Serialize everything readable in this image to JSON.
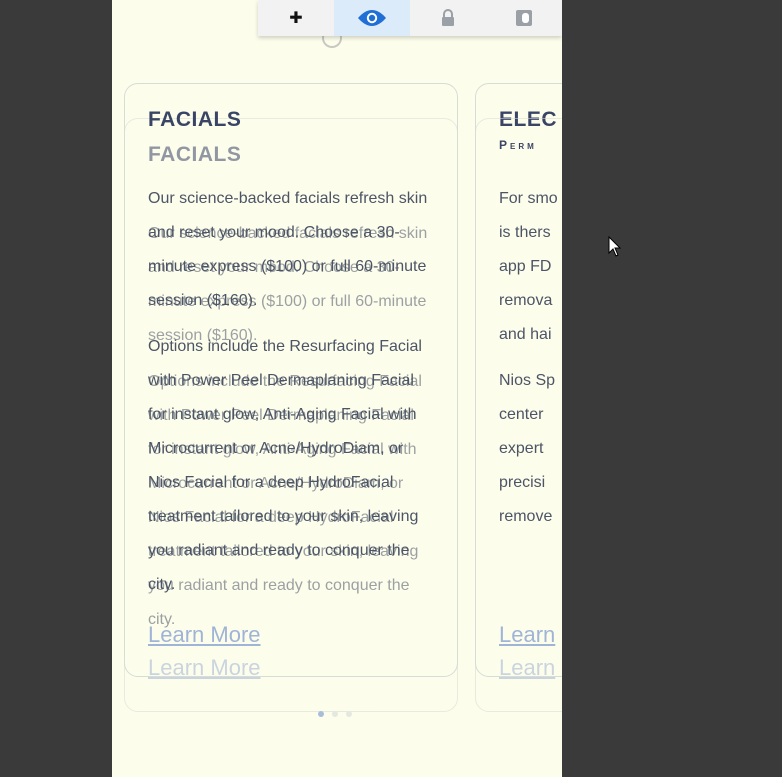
{
  "toolbar": {
    "items": [
      {
        "icon": "plus-icon",
        "glyph": "✚"
      },
      {
        "icon": "eye-icon"
      },
      {
        "icon": "lock-icon"
      },
      {
        "icon": "contrast-icon"
      }
    ]
  },
  "cards": [
    {
      "title": "FACIALS",
      "subtitle": "",
      "paragraphs": [
        "Our science-backed facials refresh skin and reset your mood. Choose a 30-minute express ($100) or full 60-minute session ($160).",
        "Options include the Resurfacing Facial with Power Peel Dermaplaning Facial for instant glow, Anti-Aging Facial with Microcurrent or Acne/HydroDiam, or Nios Facial for a deep HydroFacial treatment tailored to your skin, leaving you radiant and ready to conquer the city."
      ],
      "link": "Learn More"
    },
    {
      "title": "ELEC",
      "subtitle": "Perm",
      "paragraphs": [
        "For smo is thers app FD remova and hai",
        "Nios Sp center expert precisi remove"
      ],
      "link": "Learn"
    }
  ],
  "pagination": {
    "count": 3,
    "active": 0
  }
}
